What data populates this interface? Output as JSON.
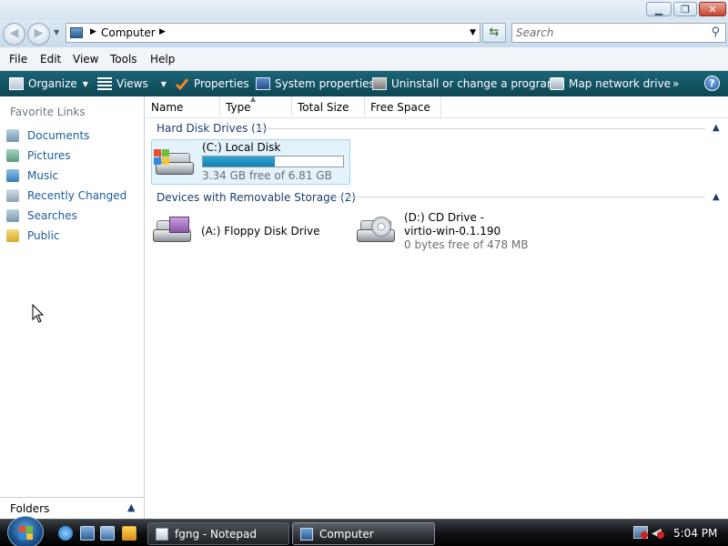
{
  "address": {
    "location": "Computer",
    "search_placeholder": "Search"
  },
  "menu": [
    "File",
    "Edit",
    "View",
    "Tools",
    "Help"
  ],
  "command_bar": {
    "organize": "Organize",
    "views": "Views",
    "properties": "Properties",
    "system_properties": "System properties",
    "uninstall": "Uninstall or change a program",
    "map_drive": "Map network drive",
    "more": "»",
    "help": "?"
  },
  "nav": {
    "favorites_title": "Favorite Links",
    "items": [
      "Documents",
      "Pictures",
      "Music",
      "Recently Changed",
      "Searches",
      "Public"
    ],
    "folders_label": "Folders"
  },
  "columns": [
    "Name",
    "Type",
    "Total Size",
    "Free Space"
  ],
  "groups": {
    "hard_disks": "Hard Disk Drives (1)",
    "removable": "Devices with Removable Storage (2)"
  },
  "drives": {
    "c": {
      "name": "(C:) Local Disk",
      "free_text": "3.34 GB free of 6.81 GB",
      "used_fraction": 0.51
    },
    "a": {
      "name": "(A:) Floppy Disk Drive"
    },
    "d": {
      "name_line1": "(D:) CD Drive -",
      "name_line2": "virtio-win-0.1.190",
      "free_text": "0 bytes free of 478 MB"
    }
  },
  "taskbar": {
    "tasks": [
      "fgng - Notepad",
      "Computer"
    ],
    "clock": "5:04 PM"
  },
  "colors": {
    "command_bar": "#14596a",
    "link": "#1b5c9e",
    "capacity_fill": "#1e90c5"
  }
}
